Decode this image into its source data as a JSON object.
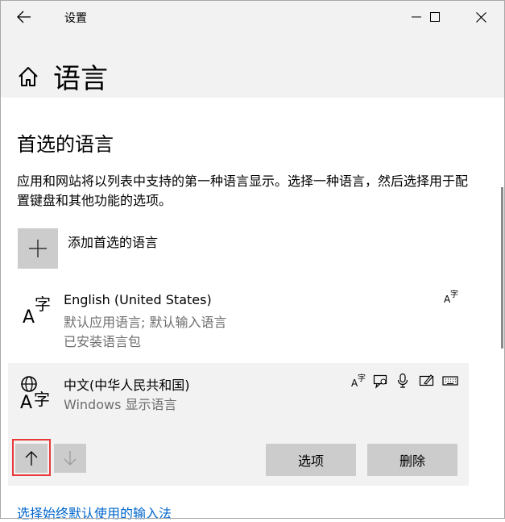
{
  "window": {
    "title": "设置"
  },
  "page": {
    "title": "语言"
  },
  "section": {
    "title": "首选的语言",
    "description": "应用和网站将以列表中支持的第一种语言显示。选择一种语言，然后选择用于配置键盘和其他功能的选项。"
  },
  "add_language": {
    "label": "添加首选的语言"
  },
  "languages": [
    {
      "name": "English (United States)",
      "line1": "默认应用语言; 默认输入语言",
      "line2": "已安装语言包",
      "glyph": "字",
      "capabilities": [
        "display-language-icon"
      ]
    },
    {
      "name": "中文(中华人民共和国)",
      "line1": "Windows 显示语言",
      "glyph": "字",
      "capabilities": [
        "display-language-icon",
        "text-to-speech-icon",
        "microphone-icon",
        "handwriting-icon",
        "keyboard-icon"
      ]
    }
  ],
  "actions": {
    "options": "选项",
    "remove": "删除"
  },
  "footer_link": "选择始终默认使用的输入法",
  "colors": {
    "accent_link": "#0066cc",
    "focus": "#e8383a",
    "panel": "#f2f2f2",
    "button": "#cccccc"
  }
}
